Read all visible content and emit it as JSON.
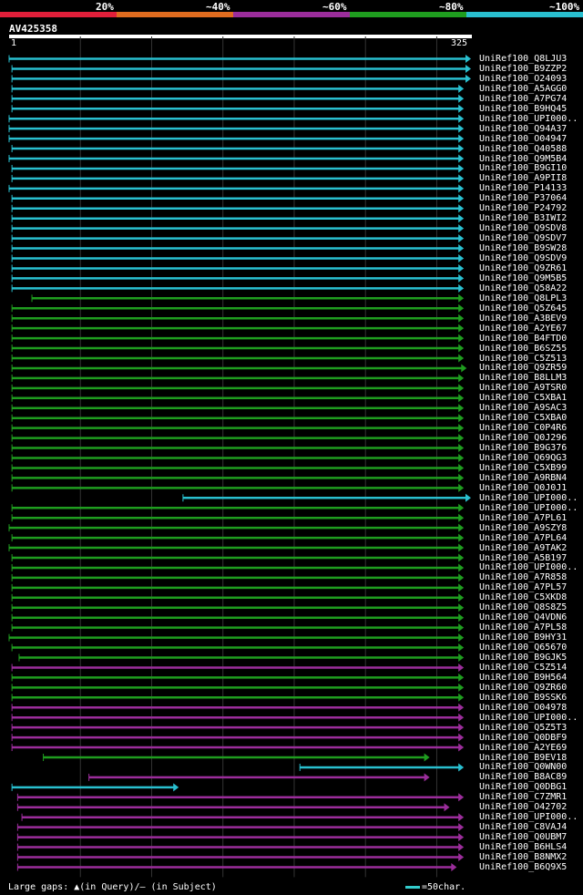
{
  "legend": {
    "segments": [
      {
        "label": "20%",
        "color": "#e11f3a"
      },
      {
        "label": "~40%",
        "color": "#e06c1f"
      },
      {
        "label": "~60%",
        "color": "#9b2d9b"
      },
      {
        "label": "~80%",
        "color": "#1f9d1f"
      },
      {
        "label": "~100%",
        "color": "#29bfcf"
      }
    ]
  },
  "query": {
    "title": "AV425358",
    "start": "1",
    "end": "325"
  },
  "chart_data": {
    "type": "alignment",
    "query_length": 325,
    "identity_bins": [
      "20%",
      "~40%",
      "~60%",
      "~80%",
      "~100%"
    ],
    "hits": [
      {
        "name": "UniRef100_Q8LJU3",
        "qstart": 1,
        "qend": 325,
        "class": "~100%"
      },
      {
        "name": "UniRef100_B9ZZP2",
        "qstart": 3,
        "qend": 325,
        "class": "~100%"
      },
      {
        "name": "UniRef100_O24093",
        "qstart": 3,
        "qend": 325,
        "class": "~100%"
      },
      {
        "name": "UniRef100_A5AGG0",
        "qstart": 3,
        "qend": 320,
        "class": "~100%"
      },
      {
        "name": "UniRef100_A7PG74",
        "qstart": 3,
        "qend": 320,
        "class": "~100%"
      },
      {
        "name": "UniRef100_B9HQ45",
        "qstart": 3,
        "qend": 320,
        "class": "~100%"
      },
      {
        "name": "UniRef100_UPI000..",
        "qstart": 1,
        "qend": 320,
        "class": "~100%"
      },
      {
        "name": "UniRef100_Q94A37",
        "qstart": 1,
        "qend": 320,
        "class": "~100%"
      },
      {
        "name": "UniRef100_O04947",
        "qstart": 1,
        "qend": 320,
        "class": "~100%"
      },
      {
        "name": "UniRef100_Q40588",
        "qstart": 3,
        "qend": 320,
        "class": "~100%"
      },
      {
        "name": "UniRef100_Q9M5B4",
        "qstart": 1,
        "qend": 320,
        "class": "~100%"
      },
      {
        "name": "UniRef100_B9GI10",
        "qstart": 3,
        "qend": 320,
        "class": "~100%"
      },
      {
        "name": "UniRef100_A9PII8",
        "qstart": 3,
        "qend": 320,
        "class": "~100%"
      },
      {
        "name": "UniRef100_P14133",
        "qstart": 1,
        "qend": 320,
        "class": "~100%"
      },
      {
        "name": "UniRef100_P37064",
        "qstart": 3,
        "qend": 320,
        "class": "~100%"
      },
      {
        "name": "UniRef100_P24792",
        "qstart": 3,
        "qend": 320,
        "class": "~100%"
      },
      {
        "name": "UniRef100_B3IWI2",
        "qstart": 3,
        "qend": 320,
        "class": "~100%"
      },
      {
        "name": "UniRef100_Q9SDV8",
        "qstart": 3,
        "qend": 320,
        "class": "~100%"
      },
      {
        "name": "UniRef100_Q9SDV7",
        "qstart": 3,
        "qend": 320,
        "class": "~100%"
      },
      {
        "name": "UniRef100_B9SW28",
        "qstart": 3,
        "qend": 320,
        "class": "~100%"
      },
      {
        "name": "UniRef100_Q9SDV9",
        "qstart": 3,
        "qend": 320,
        "class": "~100%"
      },
      {
        "name": "UniRef100_Q9ZR61",
        "qstart": 3,
        "qend": 320,
        "class": "~100%"
      },
      {
        "name": "UniRef100_Q9M5B5",
        "qstart": 3,
        "qend": 320,
        "class": "~100%"
      },
      {
        "name": "UniRef100_Q58A22",
        "qstart": 3,
        "qend": 320,
        "class": "~100%"
      },
      {
        "name": "UniRef100_Q8LPL3",
        "qstart": 17,
        "qend": 320,
        "class": "~80%"
      },
      {
        "name": "UniRef100_Q5Z645",
        "qstart": 3,
        "qend": 320,
        "class": "~80%"
      },
      {
        "name": "UniRef100_A3BEV9",
        "qstart": 3,
        "qend": 320,
        "class": "~80%"
      },
      {
        "name": "UniRef100_A2YE67",
        "qstart": 3,
        "qend": 320,
        "class": "~80%"
      },
      {
        "name": "UniRef100_B4FTD0",
        "qstart": 3,
        "qend": 320,
        "class": "~80%"
      },
      {
        "name": "UniRef100_B6SZ55",
        "qstart": 3,
        "qend": 320,
        "class": "~80%"
      },
      {
        "name": "UniRef100_C5Z513",
        "qstart": 3,
        "qend": 320,
        "class": "~80%"
      },
      {
        "name": "UniRef100_Q9ZR59",
        "qstart": 3,
        "qend": 322,
        "class": "~80%"
      },
      {
        "name": "UniRef100_B8LLM3",
        "qstart": 3,
        "qend": 320,
        "class": "~80%"
      },
      {
        "name": "UniRef100_A9TSR0",
        "qstart": 3,
        "qend": 320,
        "class": "~80%"
      },
      {
        "name": "UniRef100_C5XBA1",
        "qstart": 3,
        "qend": 320,
        "class": "~80%"
      },
      {
        "name": "UniRef100_A9SAC3",
        "qstart": 3,
        "qend": 320,
        "class": "~80%"
      },
      {
        "name": "UniRef100_C5XBA0",
        "qstart": 3,
        "qend": 320,
        "class": "~80%"
      },
      {
        "name": "UniRef100_C0P4R6",
        "qstart": 3,
        "qend": 320,
        "class": "~80%"
      },
      {
        "name": "UniRef100_Q0J296",
        "qstart": 3,
        "qend": 320,
        "class": "~80%"
      },
      {
        "name": "UniRef100_B9G376",
        "qstart": 3,
        "qend": 320,
        "class": "~80%"
      },
      {
        "name": "UniRef100_Q69QG3",
        "qstart": 3,
        "qend": 320,
        "class": "~80%"
      },
      {
        "name": "UniRef100_C5XB99",
        "qstart": 3,
        "qend": 320,
        "class": "~80%"
      },
      {
        "name": "UniRef100_A9RBN4",
        "qstart": 3,
        "qend": 320,
        "class": "~80%"
      },
      {
        "name": "UniRef100_Q0J0J1",
        "qstart": 3,
        "qend": 320,
        "class": "~80%"
      },
      {
        "name": "UniRef100_UPI000..",
        "qstart": 123,
        "qend": 325,
        "class": "~100%"
      },
      {
        "name": "UniRef100_UPI000..",
        "qstart": 3,
        "qend": 320,
        "class": "~80%"
      },
      {
        "name": "UniRef100_A7PL61",
        "qstart": 3,
        "qend": 320,
        "class": "~80%"
      },
      {
        "name": "UniRef100_A9SZY8",
        "qstart": 1,
        "qend": 320,
        "class": "~80%"
      },
      {
        "name": "UniRef100_A7PL64",
        "qstart": 3,
        "qend": 320,
        "class": "~80%"
      },
      {
        "name": "UniRef100_A9TAK2",
        "qstart": 1,
        "qend": 320,
        "class": "~80%"
      },
      {
        "name": "UniRef100_A5B197",
        "qstart": 3,
        "qend": 320,
        "class": "~80%"
      },
      {
        "name": "UniRef100_UPI000..",
        "qstart": 3,
        "qend": 320,
        "class": "~80%"
      },
      {
        "name": "UniRef100_A7R858",
        "qstart": 3,
        "qend": 320,
        "class": "~80%"
      },
      {
        "name": "UniRef100_A7PL57",
        "qstart": 3,
        "qend": 320,
        "class": "~80%"
      },
      {
        "name": "UniRef100_C5XKD8",
        "qstart": 3,
        "qend": 320,
        "class": "~80%"
      },
      {
        "name": "UniRef100_Q8S8Z5",
        "qstart": 3,
        "qend": 320,
        "class": "~80%"
      },
      {
        "name": "UniRef100_Q4VDN6",
        "qstart": 3,
        "qend": 320,
        "class": "~80%"
      },
      {
        "name": "UniRef100_A7PL58",
        "qstart": 3,
        "qend": 320,
        "class": "~80%"
      },
      {
        "name": "UniRef100_B9HY31",
        "qstart": 1,
        "qend": 320,
        "class": "~80%"
      },
      {
        "name": "UniRef100_Q65670",
        "qstart": 3,
        "qend": 320,
        "class": "~80%"
      },
      {
        "name": "UniRef100_B9GJK5",
        "qstart": 8,
        "qend": 320,
        "class": "~80%"
      },
      {
        "name": "UniRef100_C5Z514",
        "qstart": 3,
        "qend": 320,
        "class": "~60%"
      },
      {
        "name": "UniRef100_B9H564",
        "qstart": 3,
        "qend": 320,
        "class": "~80%"
      },
      {
        "name": "UniRef100_Q9ZR60",
        "qstart": 3,
        "qend": 320,
        "class": "~80%"
      },
      {
        "name": "UniRef100_B9SSK6",
        "qstart": 3,
        "qend": 320,
        "class": "~80%"
      },
      {
        "name": "UniRef100_O04978",
        "qstart": 3,
        "qend": 320,
        "class": "~60%"
      },
      {
        "name": "UniRef100_UPI000..",
        "qstart": 3,
        "qend": 320,
        "class": "~60%"
      },
      {
        "name": "UniRef100_Q5Z5T3",
        "qstart": 3,
        "qend": 320,
        "class": "~60%"
      },
      {
        "name": "UniRef100_Q0DBF9",
        "qstart": 3,
        "qend": 320,
        "class": "~60%"
      },
      {
        "name": "UniRef100_A2YE69",
        "qstart": 3,
        "qend": 320,
        "class": "~60%"
      },
      {
        "name": "UniRef100_B9EV18",
        "qstart": 25,
        "qend": 296,
        "class": "~80%"
      },
      {
        "name": "UniRef100_Q0WN00",
        "qstart": 205,
        "qend": 320,
        "class": "~100%"
      },
      {
        "name": "UniRef100_B8AC89",
        "qstart": 57,
        "qend": 296,
        "class": "~60%"
      },
      {
        "name": "UniRef100_Q0DBG1",
        "qstart": 3,
        "qend": 120,
        "class": "~100%"
      },
      {
        "name": "UniRef100_C7ZMR1",
        "qstart": 7,
        "qend": 320,
        "class": "~60%"
      },
      {
        "name": "UniRef100_O42702",
        "qstart": 7,
        "qend": 310,
        "class": "~60%"
      },
      {
        "name": "UniRef100_UPI000..",
        "qstart": 10,
        "qend": 320,
        "class": "~60%"
      },
      {
        "name": "UniRef100_C8VAJ4",
        "qstart": 7,
        "qend": 320,
        "class": "~60%"
      },
      {
        "name": "UniRef100_Q0UBM7",
        "qstart": 7,
        "qend": 320,
        "class": "~60%"
      },
      {
        "name": "UniRef100_B6HLS4",
        "qstart": 7,
        "qend": 320,
        "class": "~60%"
      },
      {
        "name": "UniRef100_B8NMX2",
        "qstart": 7,
        "qend": 320,
        "class": "~60%"
      },
      {
        "name": "UniRef100_B6Q9X5",
        "qstart": 7,
        "qend": 315,
        "class": "~60%"
      }
    ]
  },
  "footer": {
    "note": "Large gaps: ▲(in Query)/— (in Subject)",
    "scale_label": "=50char."
  }
}
